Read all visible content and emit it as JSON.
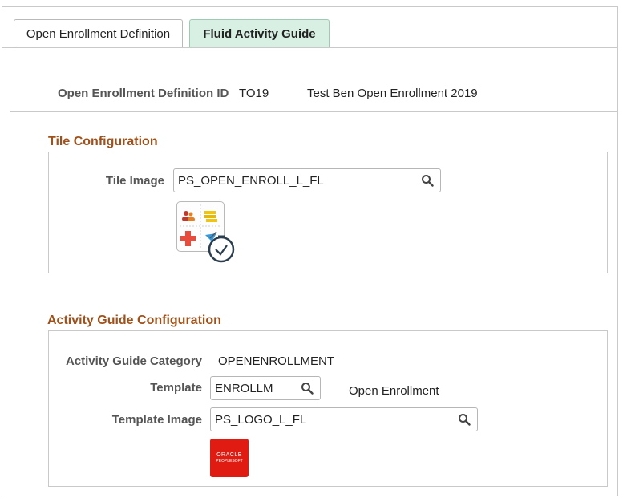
{
  "tabs": [
    {
      "label": "Open Enrollment Definition",
      "active": false
    },
    {
      "label": "Fluid Activity Guide",
      "active": true
    }
  ],
  "header": {
    "id_label": "Open Enrollment Definition ID",
    "id_value": "TO19",
    "description": "Test Ben Open Enrollment 2019"
  },
  "tile_config": {
    "title": "Tile Configuration",
    "tile_image_label": "Tile Image",
    "tile_image_value": "PS_OPEN_ENROLL_L_FL",
    "tile_icon": "open-enrollment-tile-icon"
  },
  "activity_guide": {
    "title": "Activity Guide Configuration",
    "category_label": "Activity Guide Category",
    "category_value": "OPENENROLLMENT",
    "template_label": "Template",
    "template_value": "ENROLLM",
    "template_description": "Open Enrollment",
    "template_image_label": "Template Image",
    "template_image_value": "PS_LOGO_L_FL",
    "logo": {
      "line1": "ORACLE",
      "line2": "PEOPLESOFT"
    }
  },
  "colors": {
    "section_title": "#a0511a",
    "active_tab_bg": "#d7f0e3",
    "logo_red": "#e01b12"
  }
}
